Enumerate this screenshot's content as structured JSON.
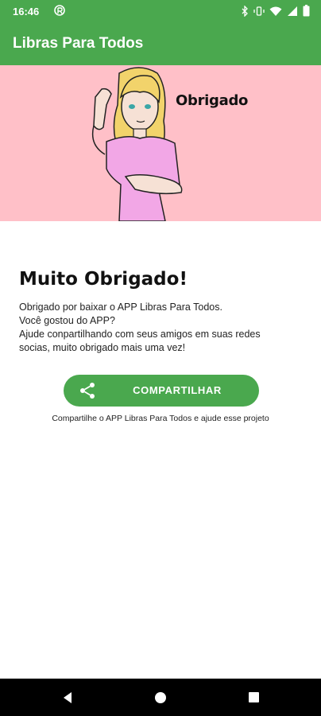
{
  "status_bar": {
    "time": "16:46",
    "icons": [
      "app-notification-icon",
      "bluetooth-icon",
      "vibrate-icon",
      "wifi-icon",
      "signal-icon",
      "battery-icon"
    ]
  },
  "app_bar": {
    "title": "Libras Para Todos"
  },
  "banner": {
    "word": "Obrigado",
    "background": "#ffc0c8"
  },
  "content": {
    "heading": "Muito Obrigado!",
    "lines": [
      "Obrigado por baixar o APP Libras Para Todos.",
      "Você gostou do APP?",
      "Ajude conpartilhando com seus amigos em suas redes",
      "socias, muito obrigado mais uma vez!"
    ]
  },
  "share": {
    "button_label": "COMPARTILHAR",
    "icon": "share-icon",
    "note": "Compartilhe o APP Libras Para Todos e ajude esse projeto"
  },
  "colors": {
    "primary": "#4aa84e",
    "banner": "#ffc0c8"
  },
  "nav_bar": {
    "icons": [
      "back-icon",
      "home-icon",
      "recents-icon"
    ]
  }
}
